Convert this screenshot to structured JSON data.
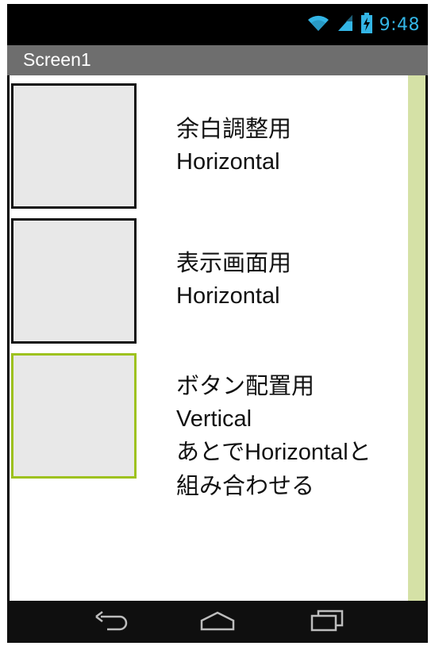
{
  "status_bar": {
    "time": "9:48",
    "icons": [
      "wifi-icon",
      "signal-icon",
      "battery-charging-icon"
    ],
    "accent_color": "#33b5e5"
  },
  "title_bar": {
    "title": "Screen1"
  },
  "arrangements": [
    {
      "line1": "余白調整用",
      "line2": "Horizontal"
    },
    {
      "line1": "表示画面用",
      "line2": "Horizontal"
    },
    {
      "line1": "ボタン配置用",
      "line2": "Vertical",
      "line3": "あとでHorizontalと",
      "line4": "組み合わせる"
    }
  ],
  "colors": {
    "selected_border": "#9ec21f",
    "scrollbar": "#d5e1a6"
  },
  "nav_bar": {
    "icons": [
      "back-icon",
      "home-icon",
      "recent-apps-icon"
    ]
  }
}
